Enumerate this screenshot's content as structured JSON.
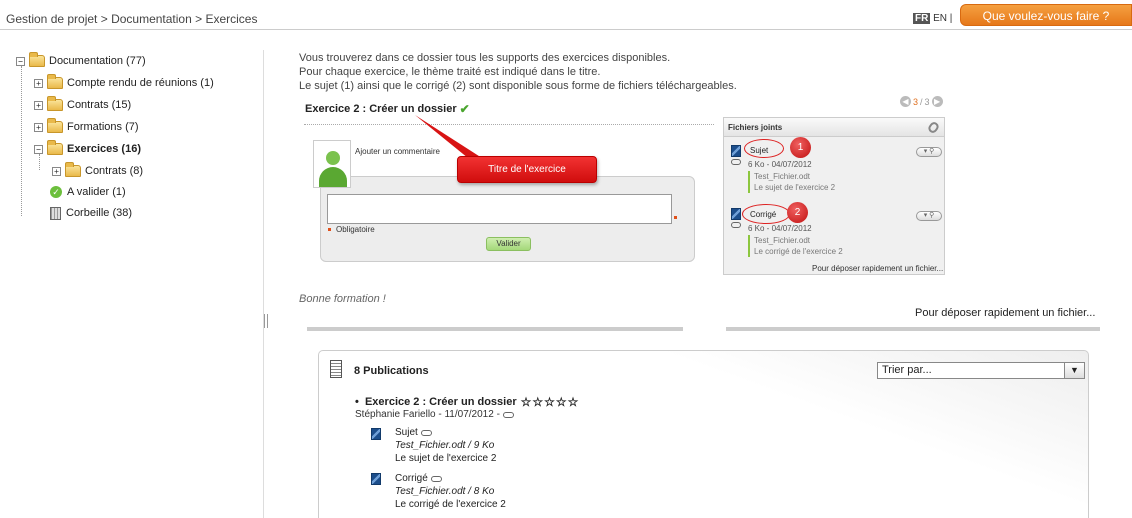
{
  "header": {
    "breadcrumb": "Gestion de projet > Documentation > Exercices",
    "lang_fr": "FR",
    "lang_en": "EN |",
    "cta_label": "Que voulez-vous faire ?"
  },
  "tree": {
    "root": "Documentation (77)",
    "items": [
      {
        "label": "Compte rendu de réunions (1)"
      },
      {
        "label": "Contrats (15)"
      },
      {
        "label": "Formations (7)"
      },
      {
        "label": "Exercices (16)"
      },
      {
        "label": "Contrats (8)"
      },
      {
        "label": "A valider (1)"
      },
      {
        "label": "Corbeille (38)"
      }
    ]
  },
  "intro": {
    "line1": "Vous trouverez dans ce dossier tous les supports des exercices disponibles.",
    "line2": "Pour chaque exercice, le thème traité est indiqué dans le titre.",
    "line3": "Le sujet (1) ainsi que le corrigé (2) sont disponible sous forme de fichiers téléchargeables."
  },
  "pager": {
    "current": "3",
    "sep": "/",
    "total": "3"
  },
  "publication": {
    "title": "Exercice 2 : Créer un dossier",
    "add_comment": "Ajouter un commentaire",
    "mandatory": "Obligatoire",
    "validate": "Valider",
    "callout": "Titre de l'exercice"
  },
  "attachments": {
    "title": "Fichiers joints",
    "files": [
      {
        "name": "Sujet",
        "meta": "6 Ko - 04/07/2012",
        "file": "Test_Fichier.odt",
        "desc": "Le sujet de l'exercice 2",
        "badge": "1"
      },
      {
        "name": "Corrigé",
        "meta": "6 Ko - 04/07/2012",
        "file": "Test_Fichier.odt",
        "desc": "Le corrigé de l'exercice 2",
        "badge": "2"
      }
    ],
    "footer": "Pour déposer rapidement un fichier..."
  },
  "bonne": "Bonne formation !",
  "quick_drop": "Pour déposer rapidement un fichier...",
  "publications": {
    "title": "8 Publications",
    "sort_value": "Trier par...",
    "item_title": "Exercice 2 : Créer un dossier",
    "stars": "☆☆☆☆☆",
    "author": "Stéphanie Fariello - 11/07/2012 -",
    "files": [
      {
        "name": "Sujet",
        "file": "Test_Fichier.odt / 9 Ko",
        "desc": "Le sujet de l'exercice 2"
      },
      {
        "name": "Corrigé",
        "file": "Test_Fichier.odt / 8 Ko",
        "desc": "Le corrigé de l'exercice 2"
      }
    ]
  }
}
